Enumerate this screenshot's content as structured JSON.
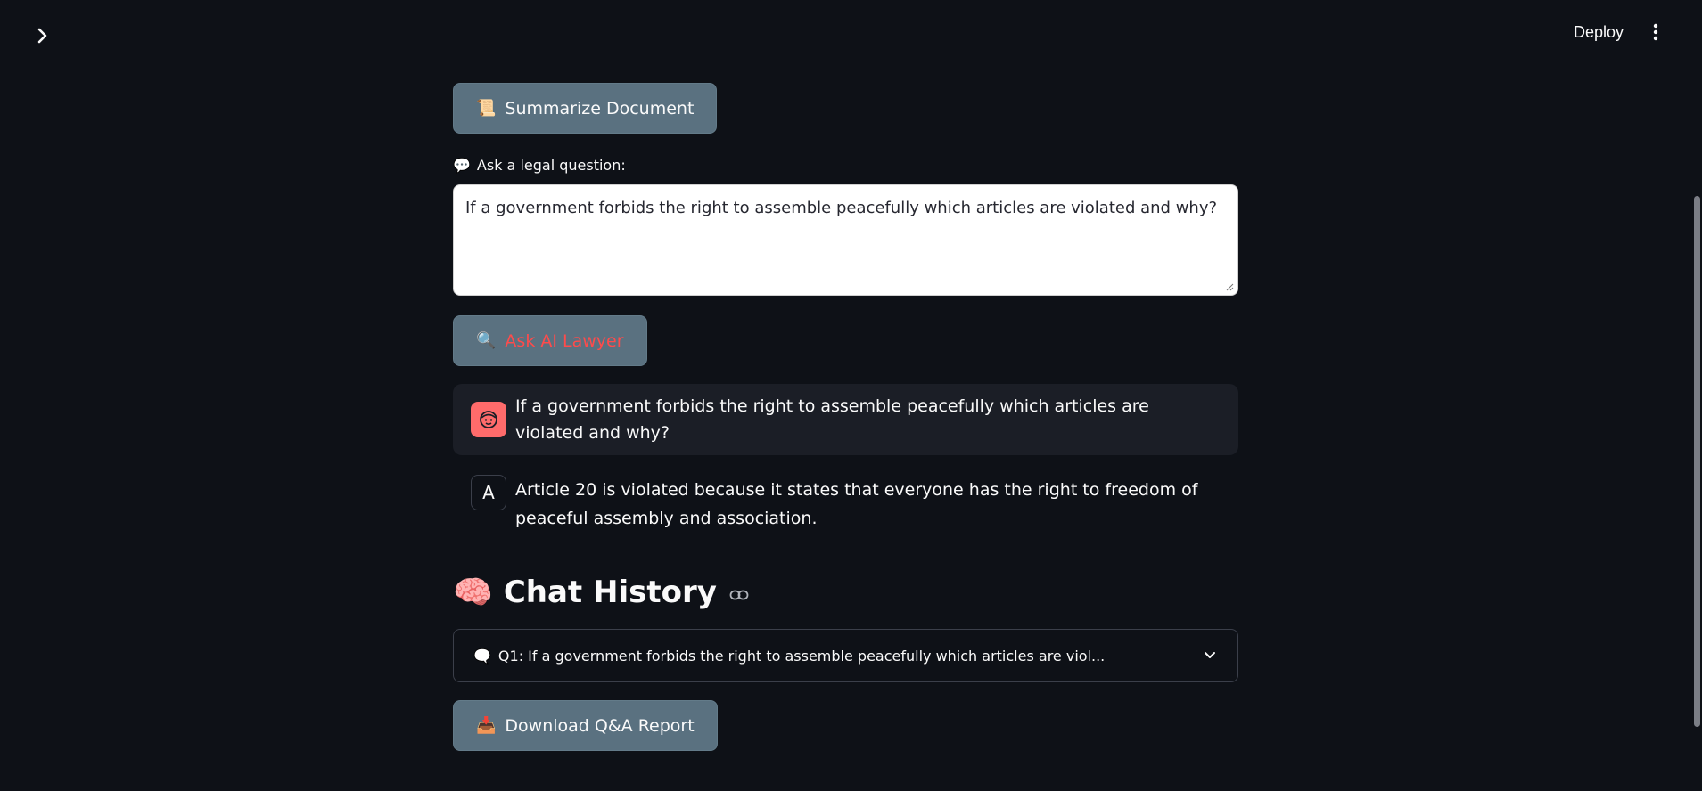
{
  "header": {
    "deploy_label": "Deploy"
  },
  "main": {
    "summarize_button": {
      "emoji": "📜",
      "label": "Summarize Document"
    },
    "question_label": {
      "emoji": "💬",
      "text": "Ask a legal question:"
    },
    "question_input": {
      "value": "If a government forbids the right to assemble peacefully which articles are violated and why?"
    },
    "ask_button": {
      "emoji": "🔍",
      "label": "Ask AI Lawyer"
    },
    "chat": {
      "user_message": "If a government forbids the right to assemble peacefully which articles are violated and why?",
      "assistant_avatar": "A",
      "assistant_message": "Article 20 is violated because it states that everyone has the right to freedom of peaceful assembly and association."
    },
    "history": {
      "emoji": "🧠",
      "title": "Chat History",
      "items": [
        {
          "emoji": "🗨️",
          "label": "Q1: If a government forbids the right to assemble peacefully which articles are viol..."
        }
      ]
    },
    "download_button": {
      "emoji": "📥",
      "label": "Download Q&A Report"
    }
  },
  "colors": {
    "background": "#0e1117",
    "button_bg": "#5a7180",
    "accent_red": "#ff4b4b",
    "user_avatar": "#ff6b6b",
    "chat_user_bg": "#1b1e26"
  },
  "icons": {
    "sidebar_toggle": "chevron-right-icon",
    "menu": "vertical-dots-icon",
    "link": "link-icon",
    "expander": "chevron-down-icon",
    "user_avatar": "face-icon"
  }
}
